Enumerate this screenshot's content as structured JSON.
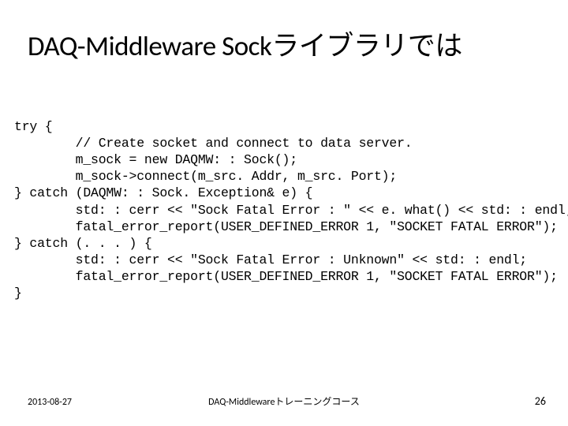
{
  "title": "DAQ-Middleware Sockライブラリでは",
  "code": "try {\n        // Create socket and connect to data server.\n        m_sock = new DAQMW: : Sock();\n        m_sock->connect(m_src. Addr, m_src. Port);\n} catch (DAQMW: : Sock. Exception& e) {\n        std: : cerr << \"Sock Fatal Error : \" << e. what() << std: : endl;\n        fatal_error_report(USER_DEFINED_ERROR 1, \"SOCKET FATAL ERROR\");\n} catch (. . . ) {\n        std: : cerr << \"Sock Fatal Error : Unknown\" << std: : endl;\n        fatal_error_report(USER_DEFINED_ERROR 1, \"SOCKET FATAL ERROR\");\n}",
  "footer": {
    "date": "2013-08-27",
    "center": "DAQ-Middlewareトレーニングコース",
    "page": "26"
  }
}
